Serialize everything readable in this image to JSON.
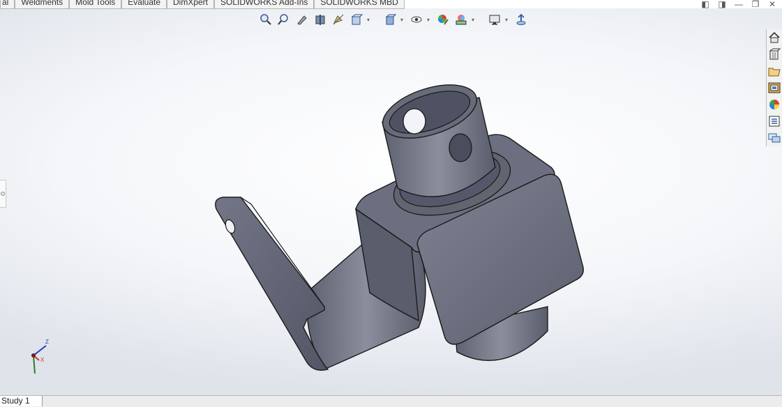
{
  "tabs": [
    "al",
    "Weldments",
    "Mold Tools",
    "Evaluate",
    "DimXpert",
    "SOLIDWORKS Add-Ins",
    "SOLIDWORKS MBD"
  ],
  "window_controls": {
    "pane_left": "◧",
    "pane_right": "◨",
    "minimize": "—",
    "restore": "❐",
    "close": "✕"
  },
  "hud_icons": [
    "zoom-to-fit-icon",
    "zoom-area-icon",
    "previous-view-icon",
    "section-view-icon",
    "dynamic-annotation-icon",
    "view-orientation-icon",
    "display-style-icon",
    "hide-show-items-icon",
    "edit-appearance-icon",
    "apply-scene-icon",
    "view-settings-icon",
    "rotate-view-icon"
  ],
  "task_pane_icons": [
    "solidworks-resources-icon",
    "design-library-icon",
    "file-explorer-icon",
    "view-palette-icon",
    "appearances-icon",
    "custom-properties-icon",
    "forum-icon"
  ],
  "triad": {
    "x": "X",
    "z": "Z"
  },
  "bottom": {
    "study_tab": "Study 1"
  },
  "colors": {
    "model_body": "#6f7283",
    "model_dark": "#4e5160",
    "model_light": "#8a8d9b",
    "background": "#f4f6f9",
    "tab_bg": "#f3f3f3"
  }
}
